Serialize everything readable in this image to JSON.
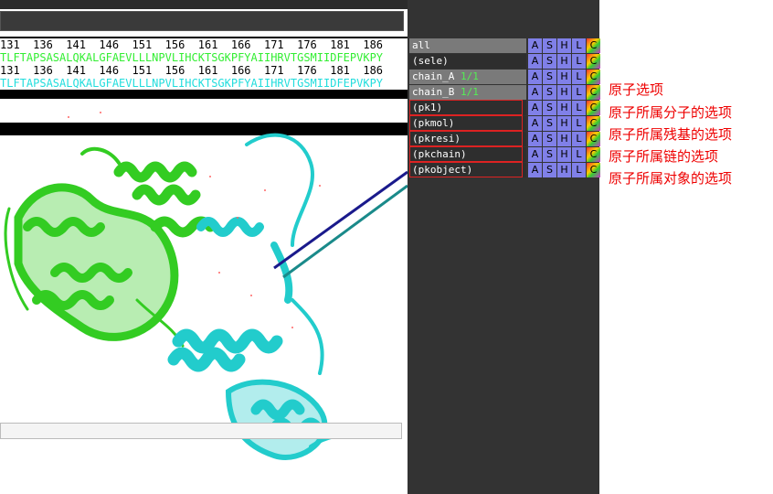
{
  "sequence": {
    "numbers_line_1": "131  136  141  146  151  156  161  166  171  176  181  186",
    "residues_line_1": "TLFTAPSASALQKALGFAEVLLLNPVLIHCKTSGKPFYAIIHRVTGSMIIDFEPVKPY",
    "numbers_line_2": "131  136  141  146  151  156  161  166  171  176  181  186",
    "residues_line_2": "TLFTAPSASALQKALGFAEVLLLNPVLIHCKTSGKPFYAIIHRVTGSMIIDFEPVKPY"
  },
  "object_panel": {
    "buttons": {
      "a": "A",
      "s": "S",
      "h": "H",
      "l": "L",
      "c": "C"
    },
    "rows": [
      {
        "label": "all",
        "frac": ""
      },
      {
        "label": "(sele)",
        "frac": ""
      },
      {
        "label": "chain_A ",
        "frac": "1/1"
      },
      {
        "label": "chain_B ",
        "frac": "1/1"
      },
      {
        "label": "(pk1)",
        "frac": ""
      },
      {
        "label": "(pkmol)",
        "frac": ""
      },
      {
        "label": "(pkresi)",
        "frac": ""
      },
      {
        "label": "(pkchain)",
        "frac": ""
      },
      {
        "label": "(pkobject)",
        "frac": ""
      }
    ]
  },
  "annotations": [
    "原子选项",
    "原子所属分子的选项",
    "原子所属残基的选项",
    "原子所属链的选项",
    "原子所属对象的选项"
  ],
  "colors": {
    "chain_a": "#33cc22",
    "chain_b": "#22cccc",
    "annotation": "#ee0000",
    "highlight_box": "#dd2222"
  }
}
